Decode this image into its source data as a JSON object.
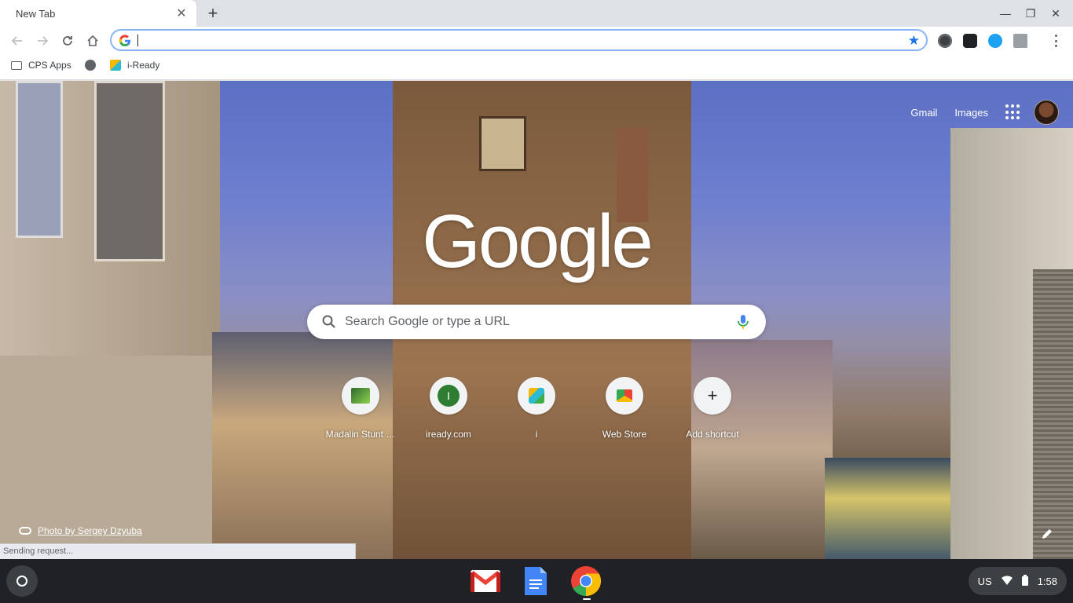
{
  "tab": {
    "title": "New Tab",
    "close_icon": "close-icon"
  },
  "window_controls": [
    "minimize-icon",
    "restore-icon",
    "close-icon"
  ],
  "omnibox": {
    "value": "",
    "placeholder": ""
  },
  "bookmarks": [
    {
      "label": "CPS Apps",
      "icon": "folder-icon"
    },
    {
      "label": "",
      "icon": "globe-icon"
    },
    {
      "label": "i-Ready",
      "icon": "iready-cube-icon"
    }
  ],
  "ntp": {
    "gmail": "Gmail",
    "images": "Images",
    "logo": "Google",
    "search_placeholder": "Search Google or type a URL",
    "shortcuts": [
      {
        "label": "Madalin Stunt …",
        "icon": "car-thumbnail-icon"
      },
      {
        "label": "iready.com",
        "icon": "letter-i-icon",
        "letter": "I"
      },
      {
        "label": "i",
        "icon": "iready-cube-icon"
      },
      {
        "label": "Web Store",
        "icon": "web-store-icon"
      },
      {
        "label": "Add shortcut",
        "icon": "plus-icon"
      }
    ],
    "attribution": "Photo by Sergey Dzyuba"
  },
  "status_bubble": "Sending request...",
  "shelf": {
    "apps": [
      "gmail-app-icon",
      "docs-app-icon",
      "chrome-app-icon"
    ],
    "tray": {
      "ime": "US",
      "time": "1:58"
    }
  },
  "colors": {
    "accent": "#1a73e8",
    "shelf": "#202124"
  }
}
